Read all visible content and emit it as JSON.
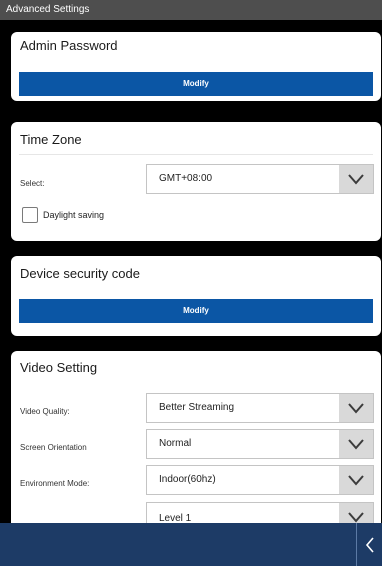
{
  "window": {
    "title": "Advanced Settings"
  },
  "admin_password": {
    "title": "Admin Password",
    "button_label": "Modify"
  },
  "time_zone": {
    "title": "Time Zone",
    "select_label": "Select:",
    "select_value": "GMT+08:00",
    "daylight_label": "Daylight saving",
    "daylight_checked": false
  },
  "device_security": {
    "title": "Device security code",
    "button_label": "Modify"
  },
  "video_setting": {
    "title": "Video Setting",
    "quality_label": "Video Quality:",
    "quality_value": "Better Streaming",
    "orientation_label": "Screen Orientation",
    "orientation_value": "Normal",
    "environment_label": "Environment Mode:",
    "environment_value": "Indoor(60hz)",
    "partial_value": "Level 1"
  },
  "icons": {
    "dropdown": "chevron-down-icon",
    "back": "chevron-left-icon"
  },
  "colors": {
    "button_blue": "#0b56a5",
    "bottom_bar": "#1d3b66",
    "title_bar": "#4e4e4e"
  }
}
